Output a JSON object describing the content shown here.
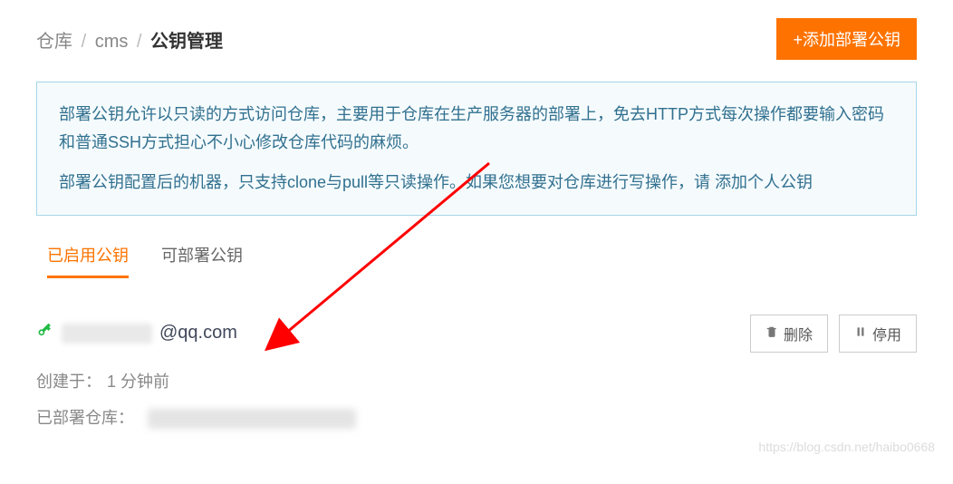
{
  "breadcrumb": {
    "root": "仓库",
    "repo": "cms",
    "current": "公钥管理"
  },
  "addButton": "+添加部署公钥",
  "notice": {
    "p1": "部署公钥允许以只读的方式访问仓库，主要用于仓库在生产服务器的部署上，免去HTTP方式每次操作都要输入密码和普通SSH方式担心不小心修改仓库代码的麻烦。",
    "p2a": "部署公钥配置后的机器，只支持clone与pull等只读操作。如果您想要对仓库进行写操作，请 ",
    "p2link": "添加个人公钥"
  },
  "tabs": {
    "enabled": "已启用公钥",
    "deployable": "可部署公钥"
  },
  "key": {
    "emailSuffix": "@qq.com",
    "createdLabel": "创建于：",
    "createdValue": "1 分钟前",
    "deployedLabel": "已部署仓库："
  },
  "actions": {
    "delete": "删除",
    "pause": "停用"
  },
  "watermark": "https://blog.csdn.net/haibo0668"
}
